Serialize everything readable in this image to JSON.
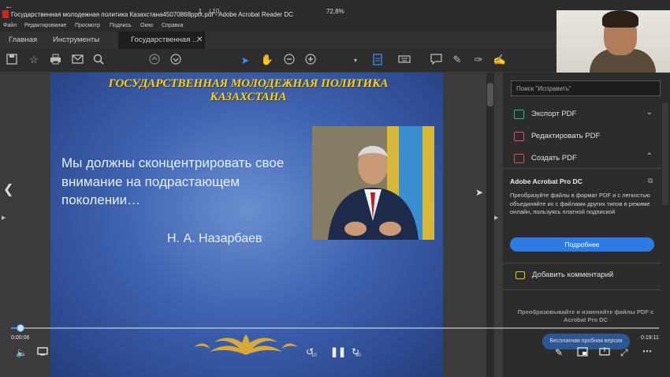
{
  "window": {
    "title": "Государственная молодежная политика Казахстана45070868pptx.pdf - Adobe Acrobat Reader DC"
  },
  "menu": [
    "Файл",
    "Редактирование",
    "Просмотр",
    "Подпись",
    "Окно",
    "Справка"
  ],
  "tabs": {
    "home": "Главная",
    "tools": "Инструменты",
    "document": "Государственная ..."
  },
  "toolbar": {
    "page_current": "1",
    "page_total": "/ 10",
    "zoom": "72,8%"
  },
  "slide": {
    "title": "ГОСУДАРСТВЕННАЯ МОЛОДЕЖНАЯ ПОЛИТИКА КАЗАХСТАНА",
    "quote": "Мы должны сконцентрировать свое внимание на подрастающем поколении…",
    "author": "Н. А. Назарбаев"
  },
  "right_panel": {
    "search_placeholder": "Поиск \"Исправить\"",
    "tools": [
      {
        "label": "Экспорт PDF",
        "color": "#1fb8a5"
      },
      {
        "label": "Редактировать PDF",
        "color": "#e8467c"
      },
      {
        "label": "Создать PDF",
        "color": "#e5484d"
      }
    ],
    "promo": {
      "title": "Adobe Acrobat Pro DC",
      "text": "Преобразуйте файлы в формат PDF и с легкостью объединяйте их с файлами других типов в режиме онлайн, пользуясь платной подпиской",
      "button": "Подробнее"
    },
    "comment": "Добавить комментарий",
    "bottom_promo": "Преобразовывайте и изменяйте файлы PDF с Acrobat Pro DC",
    "trial": "Бесплатная пробная версия"
  },
  "video": {
    "elapsed": "0:00:06",
    "duration": "0:19:11",
    "progress": 0.005,
    "rewind_label": "10",
    "forward_label": "30"
  }
}
